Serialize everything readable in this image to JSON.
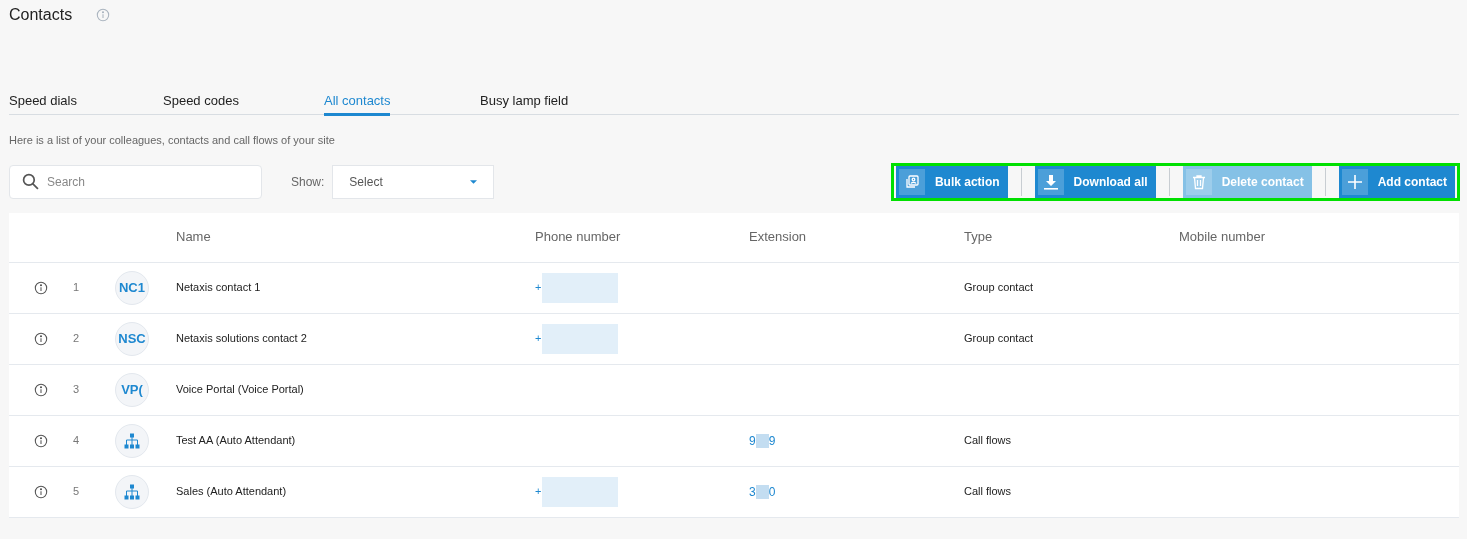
{
  "title": "Contacts",
  "tabs": [
    {
      "label": "Speed dials",
      "selected": false
    },
    {
      "label": "Speed codes",
      "selected": false
    },
    {
      "label": "All contacts",
      "selected": true
    },
    {
      "label": "Busy lamp field",
      "selected": false
    }
  ],
  "description": "Here is a list of your colleagues, contacts and call flows of your site",
  "search": {
    "placeholder": "Search"
  },
  "filter": {
    "label": "Show:",
    "value": "Select"
  },
  "toolbar": {
    "highlighted": true,
    "buttons": [
      {
        "label": "Bulk action",
        "kind": "bulk",
        "disabled": false
      },
      {
        "label": "Download all",
        "kind": "download",
        "disabled": false
      },
      {
        "label": "Delete contact",
        "kind": "trash",
        "disabled": true
      },
      {
        "label": "Add contact",
        "kind": "plus",
        "disabled": false
      }
    ]
  },
  "table": {
    "columns": [
      "Name",
      "Phone number",
      "Extension",
      "Type",
      "Mobile number"
    ],
    "rows": [
      {
        "index": "1",
        "avatar": {
          "kind": "initials",
          "text": "NC1"
        },
        "name": "Netaxis contact 1",
        "phone": "+",
        "phone_redacted": true,
        "extension": [],
        "type": "Group contact"
      },
      {
        "index": "2",
        "avatar": {
          "kind": "initials",
          "text": "NSC"
        },
        "name": "Netaxis solutions contact 2",
        "phone": "+",
        "phone_redacted": true,
        "extension": [],
        "type": "Group contact"
      },
      {
        "index": "3",
        "avatar": {
          "kind": "initials",
          "text": "VP("
        },
        "name": "Voice Portal (Voice Portal)",
        "phone_redacted": false,
        "extension": []
      },
      {
        "index": "4",
        "avatar": {
          "kind": "callflow"
        },
        "name": "Test AA (Auto Attendant)",
        "phone_redacted": false,
        "extension": [
          "9",
          "9"
        ],
        "type": "Call flows"
      },
      {
        "index": "5",
        "avatar": {
          "kind": "callflow"
        },
        "name": "Sales (Auto Attendant)",
        "phone": "+",
        "phone_redacted": true,
        "extension": [
          "3",
          "0"
        ],
        "type": "Call flows"
      }
    ]
  }
}
